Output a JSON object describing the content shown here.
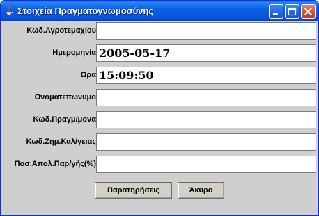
{
  "window": {
    "title": "Στοιχεία Πραγματογνωμοσύνης",
    "icon": "java-cup-icon"
  },
  "form": {
    "fields": [
      {
        "label": "Κωδ.Αγροτεμαχίου",
        "value": ""
      },
      {
        "label": "Ημερομηνία",
        "value": "2005-05-17"
      },
      {
        "label": "Ωρα",
        "value": "15:09:50"
      },
      {
        "label": "Ονοματεπώνυμο",
        "value": ""
      },
      {
        "label": "Κωδ.Πραγμ/μονα",
        "value": ""
      },
      {
        "label": "Κωδ.Ζημ.Καλ/γειας",
        "value": ""
      },
      {
        "label": "Ποσ.Απολ.Παρ/γής(%)",
        "value": ""
      }
    ]
  },
  "buttons": {
    "notes": "Παρατηρήσεις",
    "cancel": "Άκυρο"
  }
}
